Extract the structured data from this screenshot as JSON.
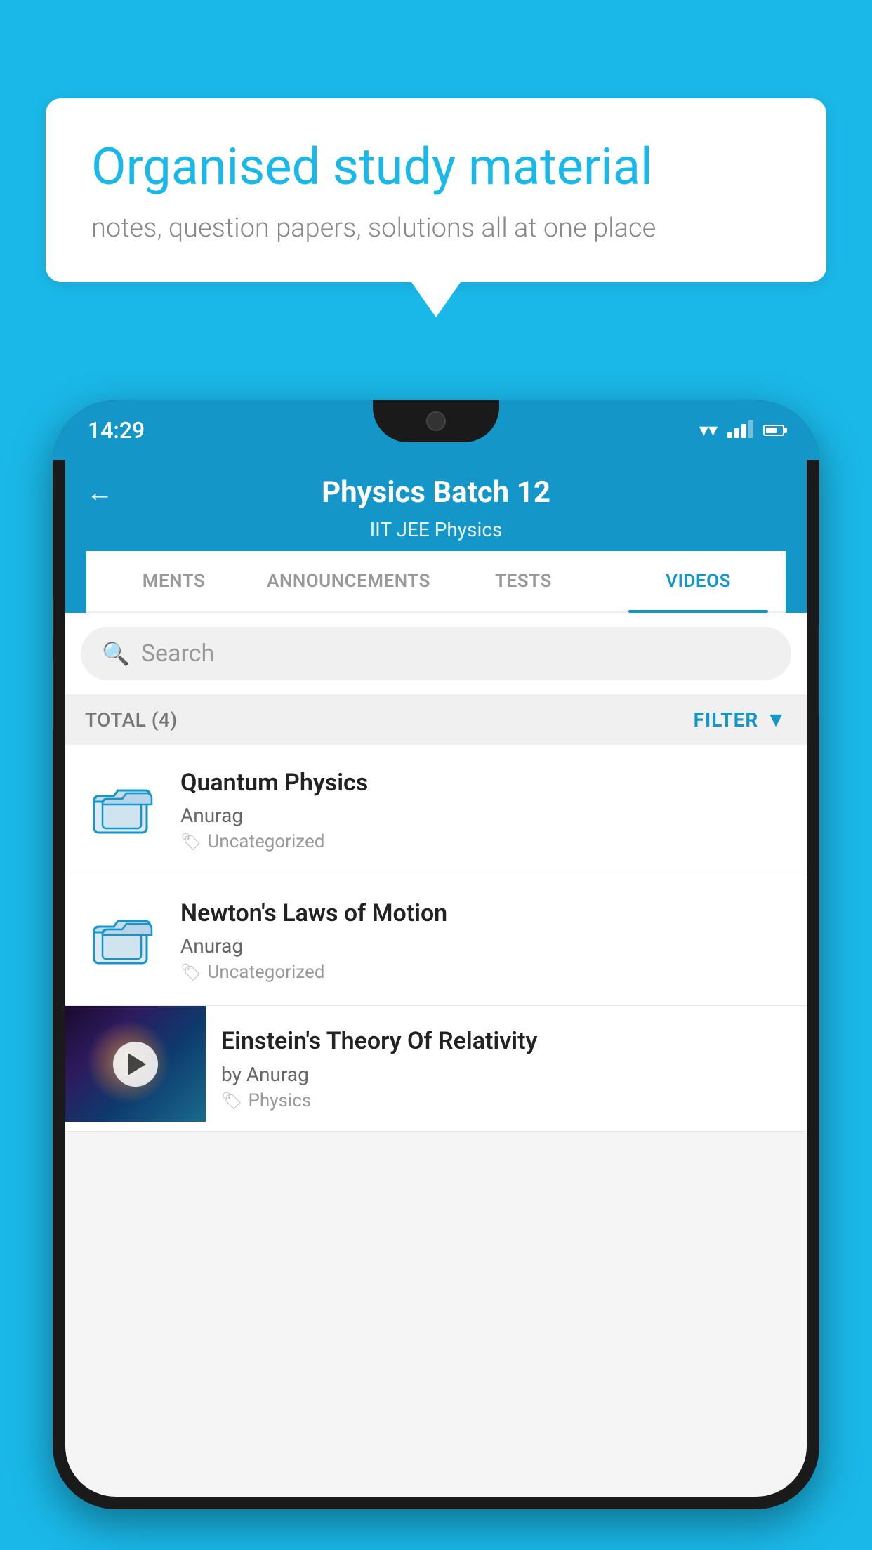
{
  "background_color": "#1ab8e8",
  "speech_bubble": {
    "title": "Organised study material",
    "subtitle": "notes, question papers, solutions all at one place"
  },
  "phone": {
    "status_bar": {
      "time": "14:29"
    },
    "app_header": {
      "title": "Physics Batch 12",
      "subtitle": "IIT JEE   Physics",
      "back_label": "←"
    },
    "tabs": [
      {
        "label": "MENTS",
        "active": false
      },
      {
        "label": "ANNOUNCEMENTS",
        "active": false
      },
      {
        "label": "TESTS",
        "active": false
      },
      {
        "label": "VIDEOS",
        "active": true
      }
    ],
    "search": {
      "placeholder": "Search"
    },
    "filter_row": {
      "total": "TOTAL (4)",
      "filter_label": "FILTER"
    },
    "videos": [
      {
        "title": "Quantum Physics",
        "author": "Anurag",
        "tag": "Uncategorized",
        "type": "folder"
      },
      {
        "title": "Newton's Laws of Motion",
        "author": "Anurag",
        "tag": "Uncategorized",
        "type": "folder"
      },
      {
        "title": "Einstein's Theory Of Relativity",
        "author": "by Anurag",
        "tag": "Physics",
        "type": "video"
      }
    ]
  }
}
